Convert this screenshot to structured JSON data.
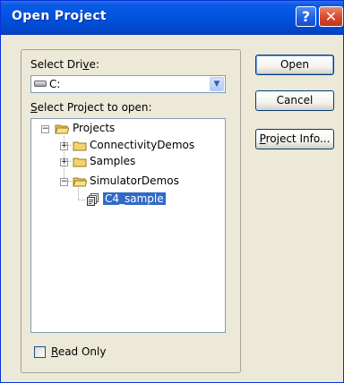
{
  "window": {
    "title": "Open Project",
    "help_glyph": "?",
    "close_glyph": "✕"
  },
  "drive": {
    "label_pre": "Select Dri",
    "label_accel": "v",
    "label_post": "e:",
    "value": "C:",
    "icon": "drive-icon"
  },
  "project": {
    "label_accel": "S",
    "label_post": "elect Project to open:"
  },
  "tree": {
    "nodes": [
      {
        "label": "Projects",
        "level": 0,
        "expander": "−",
        "icon": "folder-open-icon"
      },
      {
        "label": "ConnectivityDemos",
        "level": 1,
        "expander": "+",
        "icon": "folder-icon"
      },
      {
        "label": "Samples",
        "level": 1,
        "expander": "+",
        "icon": "folder-icon"
      },
      {
        "label": "SimulatorDemos",
        "level": 1,
        "expander": "−",
        "icon": "folder-open-icon"
      },
      {
        "label": "C4_sample",
        "level": 2,
        "expander": "",
        "icon": "project-file-icon",
        "selected": true
      }
    ]
  },
  "readonly": {
    "label_accel": "R",
    "label_post": "ead Only",
    "checked": false
  },
  "buttons": {
    "open": "Open",
    "cancel": "Cancel",
    "project_info_accel": "P",
    "project_info_post": "roject Info..."
  },
  "colors": {
    "title_bar": "#0054e3",
    "selection": "#316ac5",
    "dialog_bg": "#ece9d8"
  }
}
